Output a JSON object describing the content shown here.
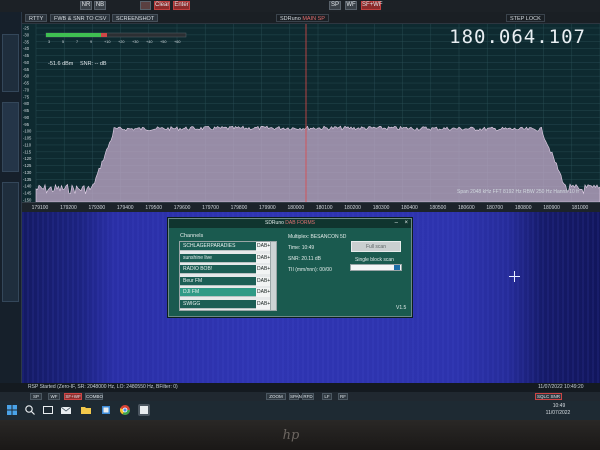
{
  "menubar": {
    "buttons": [
      "Clear",
      "Enter",
      "NR",
      "NB",
      "SP",
      "WF",
      "SF+WF"
    ],
    "red_button": "SF+WF"
  },
  "spectrum_header": {
    "left_tab": "RTTY",
    "btn_csv": "FWB & SNR TO CSV",
    "btn_screenshot": "SCREENSHOT",
    "app_label": "SDRuno",
    "app_sub": "MAIN SP",
    "step_lock": "STEP LOCK"
  },
  "spectrum": {
    "frequency": "180.064.107",
    "level_dbm": "-51.6 dBm",
    "snr": "SNR: -- dB",
    "hw_readout": "Span 2048 kHz   FFT 8192 Hz   RBW 250 Hz   Hanns 10 fr",
    "y_ticks": [
      "-25",
      "-30",
      "-35",
      "-40",
      "-45",
      "-50",
      "-55",
      "-60",
      "-65",
      "-70",
      "-75",
      "-80",
      "-85",
      "-90",
      "-95",
      "-100",
      "-105",
      "-110",
      "-115",
      "-120",
      "-125",
      "-130",
      "-135",
      "-140",
      "-145",
      "-150"
    ],
    "x_ticks": [
      "179100",
      "179200",
      "179300",
      "179400",
      "179500",
      "179600",
      "179700",
      "179800",
      "179900",
      "180000",
      "180100",
      "180200",
      "180300",
      "180400",
      "180500",
      "180600",
      "180700",
      "180800",
      "180900",
      "181000"
    ],
    "meter_scale": [
      "3",
      "5",
      "7",
      "9",
      "+10",
      "+20",
      "+30",
      "+40",
      "+50",
      "+60"
    ]
  },
  "dialog": {
    "title": "SDRuno",
    "title_sub": "DAB FORMS",
    "close": "×",
    "minimize": "–",
    "channels_heading": "Channels",
    "channels": [
      {
        "name": "SCHLAGERPARADIES",
        "type": "DAB+"
      },
      {
        "name": "sunshine live",
        "type": "DAB+"
      },
      {
        "name": "RADIO BOB!",
        "type": "DAB+"
      },
      {
        "name": "Beur FM",
        "type": "DAB+"
      },
      {
        "name": "DJI FM",
        "type": "DAB+"
      },
      {
        "name": "SWIGG",
        "type": "DAB+"
      }
    ],
    "selected_index": 4,
    "multiplex": "Multiplex: BESANCON 5D",
    "time": "Time: 10:49",
    "snr": "SNR: 20.11 dB",
    "ti": "TII (mm/nnn): 00/00",
    "full_scan": "Full scan",
    "single_block_scan": "Single block scan",
    "version": "V1.5"
  },
  "status": {
    "left": "RSP Started (Zero-IF, SR: 2048000 Hz, LO: 2480550 Hz, BFilter: 0)",
    "right": "11/07/2022  10:49:20"
  },
  "transport": {
    "left": [
      "SP",
      "WF",
      "SF+WF",
      "COMBO"
    ],
    "center": [
      "ZOOM",
      "SPAN",
      "RFD",
      "LF",
      "RF"
    ],
    "sqlc": "SQLC  SNR"
  },
  "taskbar": {
    "time": "10:49",
    "date": "11/07/2022"
  },
  "colors": {
    "spectrum_bg": "#0e2a30",
    "signal_fill": "#c6aecd",
    "waterfall": "#2f35b2",
    "dialog": "#1a5a4f",
    "selected_row": "#2f9a86"
  },
  "icons": [
    "windows-start-icon",
    "search-icon",
    "task-view-icon",
    "file-explorer-icon",
    "mail-icon",
    "folder-icon",
    "chrome-icon",
    "sdruno-icon"
  ]
}
